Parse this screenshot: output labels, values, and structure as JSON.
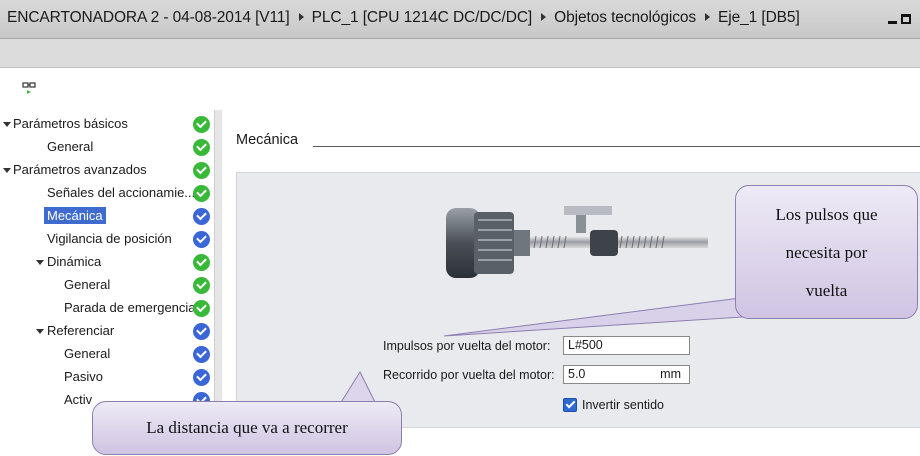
{
  "window": {
    "title": "ENCARTONADORA 2 - 04-08-2014 [V11]",
    "breadcrumb": [
      "PLC_1 [CPU 1214C DC/DC/DC]",
      "Objetos tecnológicos",
      "Eje_1 [DB5]"
    ]
  },
  "nav": {
    "items": [
      {
        "label": "Parámetros básicos",
        "status": "ok"
      },
      {
        "label": "General",
        "status": "ok"
      },
      {
        "label": "Parámetros avanzados",
        "status": "ok"
      },
      {
        "label": "Señales del accionamie...",
        "status": "ok"
      },
      {
        "label": "Mecánica",
        "status": "blue",
        "selected": true
      },
      {
        "label": "Vigilancia de posición",
        "status": "blue"
      },
      {
        "label": "Dinámica",
        "status": "ok"
      },
      {
        "label": "General",
        "status": "ok"
      },
      {
        "label": "Parada de emergencia",
        "status": "ok"
      },
      {
        "label": "Referenciar",
        "status": "blue"
      },
      {
        "label": "General",
        "status": "blue"
      },
      {
        "label": "Pasivo",
        "status": "blue"
      },
      {
        "label": "Activ",
        "status": "blue"
      }
    ]
  },
  "section": {
    "title": "Mecánica"
  },
  "fields": {
    "pulses_label": "Impulsos por vuelta del motor:",
    "pulses_value": "L#500",
    "travel_label": "Recorrido por vuelta del motor:",
    "travel_value": "5.0",
    "travel_unit": "mm",
    "invert_label": "Invertir sentido",
    "invert_checked": true
  },
  "callouts": {
    "pulses_lines": [
      "Los pulsos que",
      "necesita por",
      "vuelta"
    ],
    "distance": "La distancia que va a recorrer"
  },
  "colors": {
    "selection": "#3f6bd0",
    "status_ok": "#39b839",
    "status_blue": "#3a66d6",
    "callout": "#d9d0ea"
  }
}
